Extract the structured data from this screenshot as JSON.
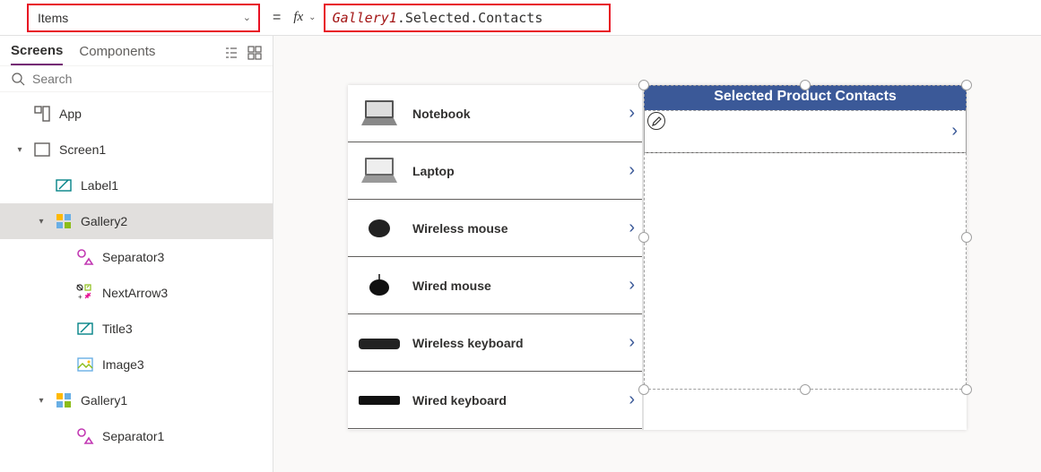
{
  "formula": {
    "property": "Items",
    "equals": "=",
    "fx": "fx",
    "expr_ident": "Gallery1",
    "expr_rest": ".Selected.Contacts"
  },
  "tabs": {
    "screens": "Screens",
    "components": "Components"
  },
  "search_placeholder": "Search",
  "tree": {
    "app": "App",
    "screen1": "Screen1",
    "label1": "Label1",
    "gallery2": "Gallery2",
    "separator3": "Separator3",
    "nextarrow3": "NextArrow3",
    "title3": "Title3",
    "image3": "Image3",
    "gallery1": "Gallery1",
    "separator1": "Separator1"
  },
  "gal2_header": "Selected Product Contacts",
  "products": [
    {
      "title": "Notebook"
    },
    {
      "title": "Laptop"
    },
    {
      "title": "Wireless mouse"
    },
    {
      "title": "Wired mouse"
    },
    {
      "title": "Wireless keyboard"
    },
    {
      "title": "Wired keyboard"
    }
  ]
}
